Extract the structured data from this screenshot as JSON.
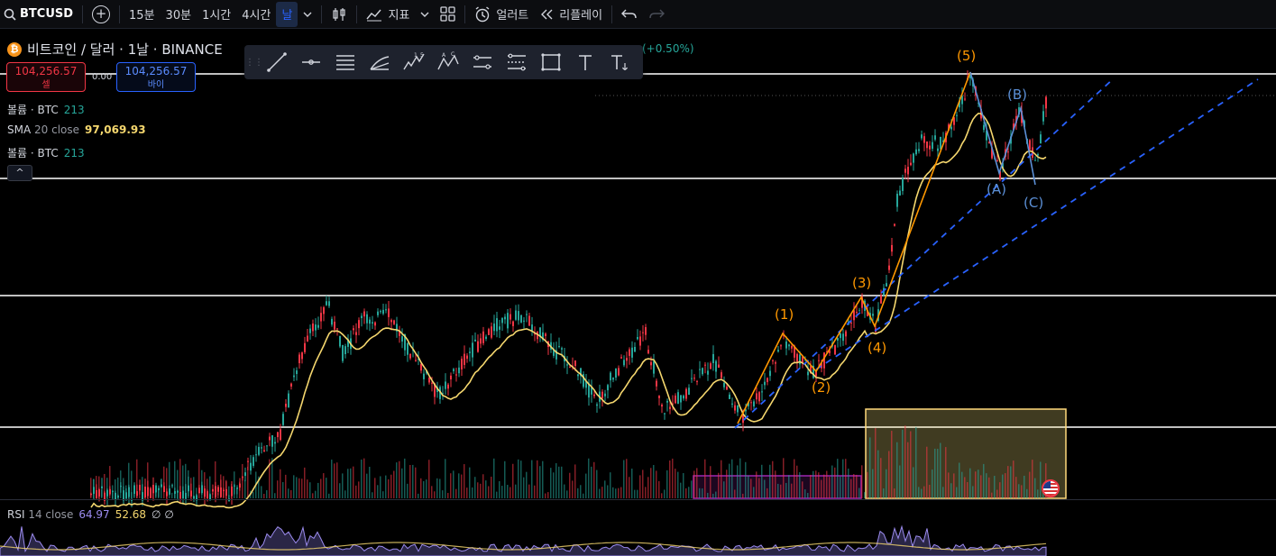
{
  "toolbar": {
    "symbol": "BTCUSD",
    "intervals": [
      "15분",
      "30분",
      "1시간",
      "4시간",
      "날"
    ],
    "active_interval": "날",
    "indicators_label": "지표",
    "alert_label": "얼러트",
    "replay_label": "리플레이"
  },
  "legend": {
    "title": "비트코인 / 달러 · 1날 · BINANCE",
    "change": "(+0.50%)",
    "sell_price": "104,256.57",
    "sell_label": "셀",
    "buy_price": "104,256.57",
    "buy_label": "바이",
    "spread": "0.00",
    "volume1_label": "볼륨 · BTC",
    "volume1_value": "213",
    "sma_label": "SMA",
    "sma_params": "20 close",
    "sma_value": "97,069.93",
    "volume2_label": "볼륨 · BTC",
    "volume2_value": "213"
  },
  "waves": {
    "w1": "(1)",
    "w2": "(2)",
    "w3": "(3)",
    "w4": "(4)",
    "w5": "(5)",
    "wa": "(A)",
    "wb": "(B)",
    "wc": "(C)"
  },
  "rsi": {
    "label": "RSI",
    "params": "14 close",
    "value1": "64.97",
    "value2": "52.68",
    "value3": "∅ ∅"
  },
  "icons": {
    "collapse": "^"
  },
  "colors": {
    "up": "#26a69a",
    "down": "#f23645",
    "sma": "#f5d76e",
    "wave_orange": "#ff9800",
    "wave_blue": "#5b8fd6",
    "trendline": "#2962ff"
  }
}
